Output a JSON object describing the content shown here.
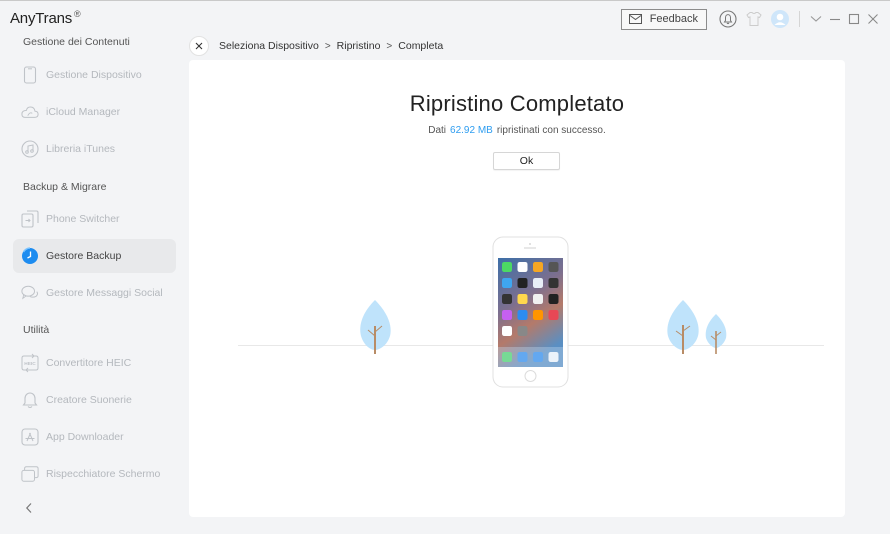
{
  "app": {
    "title": "AnyTrans",
    "trademark": "®"
  },
  "topbar": {
    "feedback_label": "Feedback",
    "icons": [
      "mail-icon",
      "bell-icon",
      "tshirt-icon",
      "avatar-icon"
    ],
    "window_controls": [
      "chevron-down-icon",
      "minimize-icon",
      "maximize-icon",
      "close-icon"
    ]
  },
  "sidebar": {
    "sections": [
      {
        "title": "Gestione dei Contenuti",
        "items": [
          {
            "label": "Gestione Dispositivo",
            "icon": "phone-icon",
            "active": false
          },
          {
            "label": "iCloud Manager",
            "icon": "cloud-icon",
            "active": false
          },
          {
            "label": "Libreria iTunes",
            "icon": "music-icon",
            "active": false
          }
        ]
      },
      {
        "title": "Backup & Migrare",
        "items": [
          {
            "label": "Phone Switcher",
            "icon": "phone-switch-icon",
            "active": false
          },
          {
            "label": "Gestore Backup",
            "icon": "backup-clock-icon",
            "active": true
          },
          {
            "label": "Gestore Messaggi Social",
            "icon": "chat-bubbles-icon",
            "active": false
          }
        ]
      },
      {
        "title": "Utilità",
        "items": [
          {
            "label": "Convertitore HEIC",
            "icon": "heic-icon",
            "active": false
          },
          {
            "label": "Creatore Suonerie",
            "icon": "bell-icon",
            "active": false
          },
          {
            "label": "App Downloader",
            "icon": "app-store-icon",
            "active": false
          },
          {
            "label": "Rispecchiatore Schermo",
            "icon": "screen-mirror-icon",
            "active": false
          }
        ]
      }
    ],
    "heic_badge": "HEIC"
  },
  "breadcrumb": {
    "items": [
      "Seleziona Dispositivo",
      "Ripristino",
      "Completa"
    ],
    "separator": ">"
  },
  "main": {
    "title": "Ripristino Completato",
    "subtitle_prefix": "Dati",
    "data_size": "62.92 MB",
    "subtitle_suffix": "ripristinati con successo.",
    "ok_label": "Ok"
  },
  "colors": {
    "accent": "#2e9df0",
    "sidebar_bg": "#f3f4f6",
    "active_item_bg": "#e8e9eb",
    "tree_leaf": "#bfe3fb",
    "tree_trunk": "#b88c66"
  }
}
